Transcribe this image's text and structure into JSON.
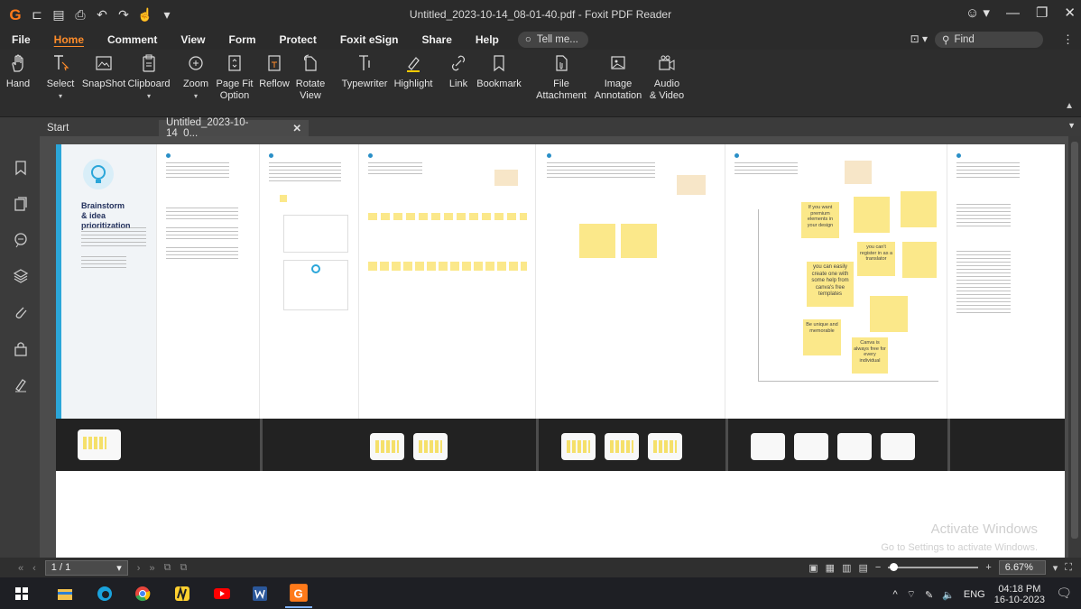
{
  "titlebar": {
    "title": "Untitled_2023-10-14_08-01-40.pdf - Foxit PDF Reader"
  },
  "menu": {
    "items": [
      {
        "label": "File",
        "active": false
      },
      {
        "label": "Home",
        "active": true
      },
      {
        "label": "Comment",
        "active": false
      },
      {
        "label": "View",
        "active": false
      },
      {
        "label": "Form",
        "active": false
      },
      {
        "label": "Protect",
        "active": false
      },
      {
        "label": "Foxit eSign",
        "active": false
      },
      {
        "label": "Share",
        "active": false
      },
      {
        "label": "Help",
        "active": false
      }
    ],
    "tell_me": "Tell me...",
    "find": "Find"
  },
  "ribbon": {
    "hand": "Hand",
    "select": "Select",
    "snapshot": "SnapShot",
    "clipboard": "Clipboard",
    "zoom": "Zoom",
    "page_fit_1": "Page Fit",
    "page_fit_2": "Option",
    "reflow": "Reflow",
    "rotate_1": "Rotate",
    "rotate_2": "View",
    "typewriter": "Typewriter",
    "highlight": "Highlight",
    "link": "Link",
    "bookmark": "Bookmark",
    "file_1": "File",
    "file_2": "Attachment",
    "image_1": "Image",
    "image_2": "Annotation",
    "audio_1": "Audio",
    "audio_2": "& Video"
  },
  "tabs": {
    "start": "Start",
    "document": "Untitled_2023-10-14_0..."
  },
  "board": {
    "title_1": "Brainstorm",
    "title_2": "& idea prioritization",
    "sticky_1": "If you want premium elements in your design",
    "sticky_2": "you can easily create one with some help from canva's free templates",
    "sticky_3": "Be unique and memorable",
    "sticky_4": "Canva is always free for every individual",
    "sticky_5": "you can't register in as a translator"
  },
  "watermark": {
    "line1": "Activate Windows",
    "line2": "Go to Settings to activate Windows."
  },
  "status": {
    "page": "1 / 1",
    "zoom": "6.67%"
  },
  "taskbar": {
    "time": "04:18 PM",
    "date": "16-10-2023",
    "lang": "ENG"
  }
}
